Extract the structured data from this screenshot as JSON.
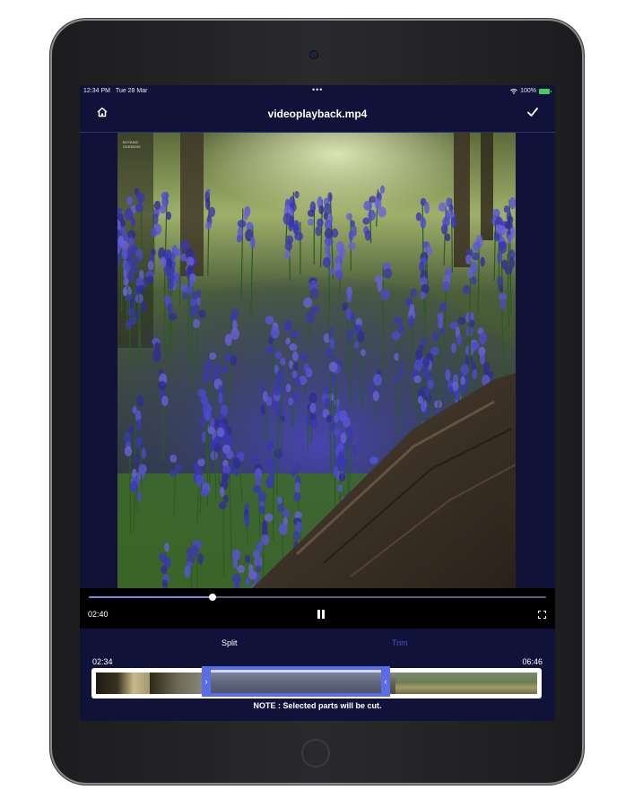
{
  "status_bar": {
    "time": "12:34 PM",
    "date": "Tue 28 Mar",
    "dots": "•••",
    "battery_text": "100%"
  },
  "navbar": {
    "title": "videoplayback.mp4",
    "home_icon": "home-icon",
    "done_icon": "checkmark-icon"
  },
  "video": {
    "watermark_line1": "BOTANIC",
    "watermark_line2": "GARDENS"
  },
  "player": {
    "current_time": "02:40",
    "progress": 0.27,
    "pause_icon": "pause-icon",
    "fullscreen_icon": "fullscreen-icon"
  },
  "editor": {
    "modes": [
      "Split",
      "Trim"
    ],
    "active_mode": "Trim",
    "timeline_start": "02:34",
    "timeline_end": "06:46",
    "note": "NOTE : Selected parts will be cut."
  },
  "colors": {
    "screen_bg": "#10123a",
    "accent": "#5a6de8",
    "trim_active": "#4a55c8"
  }
}
